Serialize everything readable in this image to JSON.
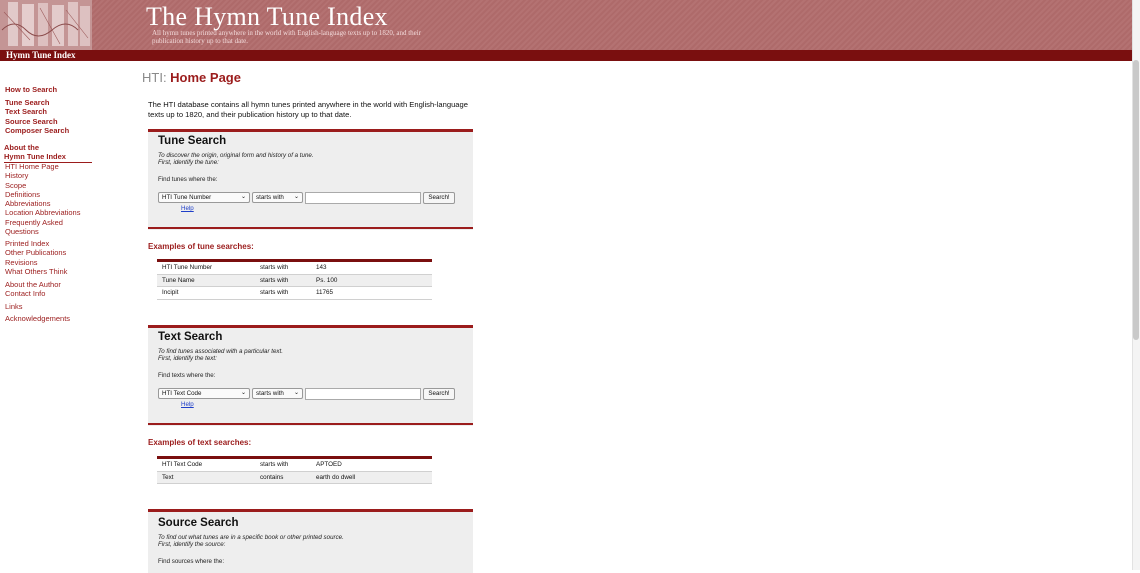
{
  "header": {
    "title": "The Hymn Tune Index",
    "subtitle": "All hymn tunes printed anywhere in the world with English-language texts up to 1820, and their publication history up to that date.",
    "bar_label": "Hymn Tune Index"
  },
  "sidebar": {
    "group1": [
      "How to Search"
    ],
    "group2": [
      "Tune Search",
      "Text Search",
      "Source Search",
      "Composer Search"
    ],
    "about_label": [
      "About the",
      "Hymn Tune Index"
    ],
    "group3": [
      "HTI Home Page",
      "History",
      "Scope",
      "Definitions",
      "Abbreviations",
      "Location Abbreviations",
      "Frequently Asked",
      "Questions"
    ],
    "group4": [
      "Printed Index",
      "Other Publications",
      "Revisions",
      "What Others Think"
    ],
    "group5": [
      "About the Author",
      "Contact Info"
    ],
    "group6": [
      "Links"
    ],
    "group7": [
      "Acknowledgements"
    ]
  },
  "page": {
    "heading_prefix": "HTI: ",
    "heading": "Home Page",
    "intro": "The HTI database contains all hymn tunes printed anywhere in the world with English-language texts up to 1820, and their publication history up to that date."
  },
  "tune_search": {
    "title": "Tune Search",
    "desc1": "To discover the origin, original form and history of a tune.",
    "desc2": "First, identify the tune:",
    "find": "Find tunes where the:",
    "field": "HTI Tune Number",
    "op": "starts with",
    "value": "",
    "button": "Search!",
    "help": "Help",
    "examples_title": "Examples of tune searches:",
    "examples": [
      [
        "HTI Tune Number",
        "starts with",
        "143"
      ],
      [
        "Tune Name",
        "starts with",
        "Ps. 100"
      ],
      [
        "Incipit",
        "starts with",
        "11765"
      ]
    ]
  },
  "text_search": {
    "title": "Text Search",
    "desc1": "To find tunes associated with a particular text.",
    "desc2": "First, identify the text:",
    "find": "Find texts where the:",
    "field": "HTI Text Code",
    "op": "starts with",
    "value": "",
    "button": "Search!",
    "help": "Help",
    "examples_title": "Examples of text searches:",
    "examples": [
      [
        "HTI Text Code",
        "starts with",
        "APTOED"
      ],
      [
        "Text",
        "contains",
        "earth do dwell"
      ]
    ]
  },
  "source_search": {
    "title": "Source Search",
    "desc1": "To find out what tunes are in a specific book or other printed source.",
    "desc2": "First, identify the source:",
    "find": "Find sources where the:"
  },
  "colors": {
    "brand": "#9b1c1c",
    "banner": "#b47272",
    "bar": "#7a0f0f",
    "link": "#1f3fc9"
  },
  "icons": [
    "chevron-down-icon"
  ]
}
